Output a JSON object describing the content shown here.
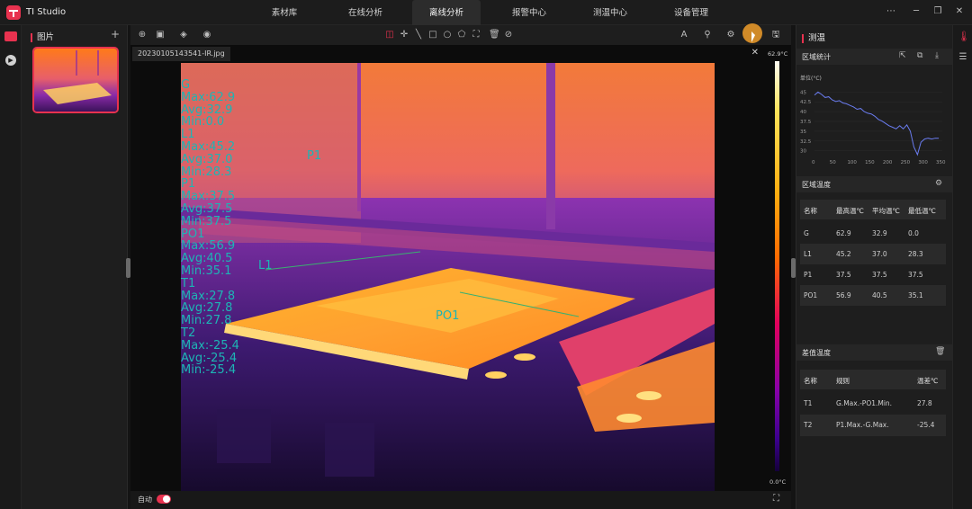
{
  "app": {
    "name": "TI Studio"
  },
  "nav_tabs": [
    {
      "label": "素材库"
    },
    {
      "label": "在线分析"
    },
    {
      "label": "离线分析"
    },
    {
      "label": "报警中心"
    },
    {
      "label": "测温中心"
    },
    {
      "label": "设备管理"
    }
  ],
  "active_tab": "离线分析",
  "gallery": {
    "title": "图片",
    "add": "+"
  },
  "viewer": {
    "file_name": "20230105143541-IR.jpg",
    "colorbar_max": "62.9°C",
    "colorbar_min": "0.0°C",
    "auto_label": "自动",
    "auto_on": true,
    "overlay_lines": [
      "G",
      "Max:62.9",
      "Avg:32.9",
      "Min:0.0",
      "L1",
      "Max:45.2",
      "Avg:37.0",
      "Min:28.3",
      "P1",
      "Max:37.5",
      "Avg:37.5",
      "Min:37.5",
      "PO1",
      "Max:56.9",
      "Avg:40.5",
      "Min:35.1",
      "T1",
      "Max:27.8",
      "Avg:27.8",
      "Min:27.8",
      "T2",
      "Max:-25.4",
      "Avg:-25.4",
      "Min:-25.4"
    ],
    "markers": {
      "p1": "P1",
      "l1": "L1",
      "po1": "PO1"
    }
  },
  "panel": {
    "title": "测温",
    "region_stats": {
      "title": "区域统计",
      "chart_unit": "单位(°C)",
      "chart_data": {
        "type": "line",
        "x_ticks": [
          "0",
          "50",
          "100",
          "150",
          "200",
          "250",
          "300",
          "350"
        ],
        "y_ticks": [
          "45",
          "42.5",
          "40",
          "37.5",
          "35",
          "32.5",
          "30"
        ],
        "x": [
          0,
          10,
          20,
          30,
          40,
          50,
          60,
          70,
          80,
          90,
          100,
          110,
          120,
          130,
          140,
          150,
          160,
          170,
          180,
          190,
          200,
          210,
          220,
          230,
          240,
          250,
          260,
          270,
          280,
          290,
          300,
          310,
          320,
          330,
          340,
          350
        ],
        "values": [
          44.2,
          45.0,
          44.4,
          43.6,
          43.8,
          43.0,
          42.6,
          42.8,
          42.2,
          42.0,
          41.6,
          41.2,
          40.6,
          40.8,
          40.0,
          39.6,
          39.4,
          38.8,
          38.0,
          37.6,
          37.0,
          36.4,
          36.0,
          35.6,
          36.4,
          35.6,
          36.6,
          35.0,
          31.0,
          29.0,
          32.2,
          33.0,
          33.2,
          33.0,
          33.2,
          33.2
        ],
        "xlim": [
          0,
          360
        ],
        "ylim": [
          29,
          46
        ]
      }
    },
    "region_temp": {
      "title": "区域温度",
      "headers": [
        "名称",
        "最高温℃",
        "平均温℃",
        "最低温℃"
      ],
      "rows": [
        [
          "G",
          "62.9",
          "32.9",
          "0.0"
        ],
        [
          "L1",
          "45.2",
          "37.0",
          "28.3"
        ],
        [
          "P1",
          "37.5",
          "37.5",
          "37.5"
        ],
        [
          "PO1",
          "56.9",
          "40.5",
          "35.1"
        ]
      ]
    },
    "diff_temp": {
      "title": "差值温度",
      "headers": [
        "名称",
        "规则",
        "温差℃"
      ],
      "rows": [
        [
          "T1",
          "G.Max.-PO1.Min.",
          "27.8"
        ],
        [
          "T2",
          "P1.Max.-G.Max.",
          "-25.4"
        ]
      ]
    }
  },
  "toolbar": {
    "text_tool": "A"
  }
}
